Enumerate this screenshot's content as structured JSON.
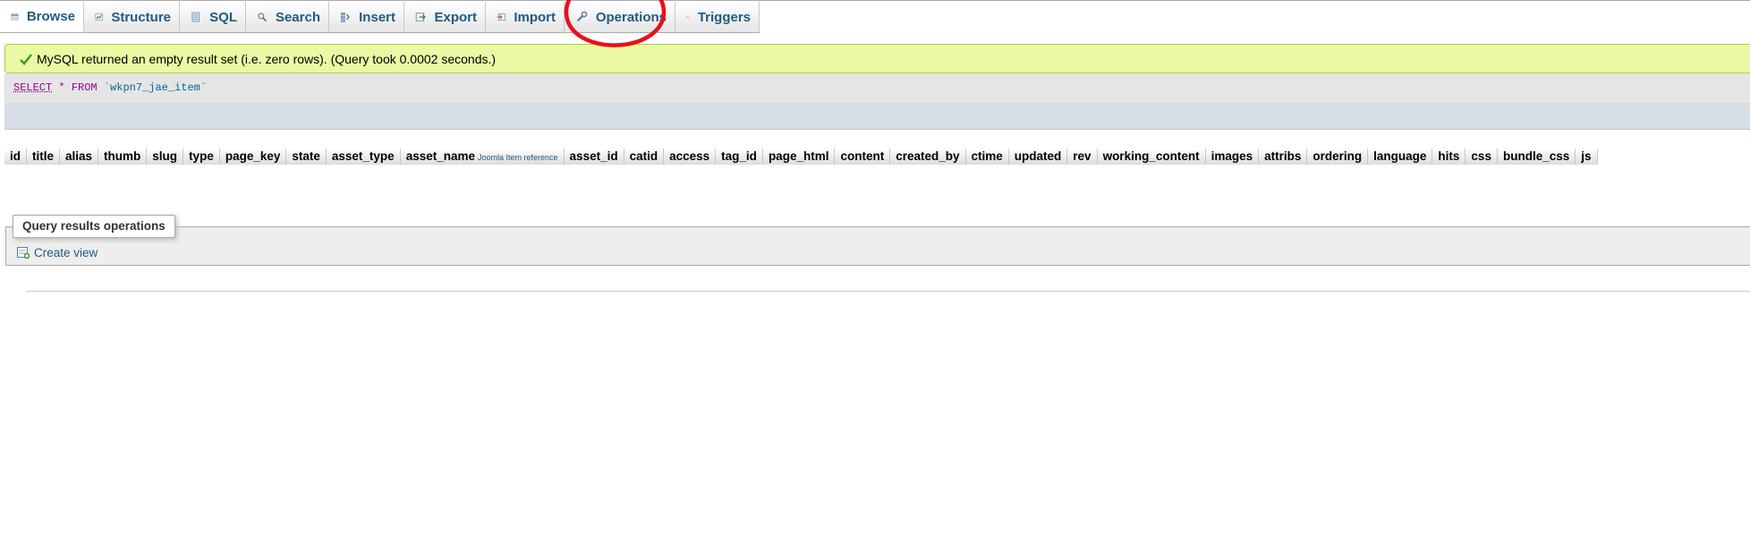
{
  "tabs": [
    {
      "label": "Browse",
      "icon": "browse-icon",
      "active": true
    },
    {
      "label": "Structure",
      "icon": "structure-icon",
      "active": false
    },
    {
      "label": "SQL",
      "icon": "sql-icon",
      "active": false
    },
    {
      "label": "Search",
      "icon": "search-icon",
      "active": false
    },
    {
      "label": "Insert",
      "icon": "insert-icon",
      "active": false
    },
    {
      "label": "Export",
      "icon": "export-icon",
      "active": false
    },
    {
      "label": "Import",
      "icon": "import-icon",
      "active": false
    },
    {
      "label": "Operations",
      "icon": "operations-icon",
      "active": false
    },
    {
      "label": "Triggers",
      "icon": "triggers-icon",
      "active": false
    }
  ],
  "message": {
    "text": "MySQL returned an empty result set (i.e. zero rows). (Query took 0.0002 seconds.)",
    "icon": "check-icon"
  },
  "sql": {
    "select": "SELECT",
    "star": "*",
    "from": "FROM",
    "table": "`wkpn7_jae_item`"
  },
  "columns": [
    "id",
    "title",
    "alias",
    "thumb",
    "slug",
    "type",
    "page_key",
    "state",
    "asset_type",
    "asset_name",
    "asset_id",
    "catid",
    "access",
    "tag_id",
    "page_html",
    "content",
    "created_by",
    "ctime",
    "updated",
    "rev",
    "working_content",
    "images",
    "attribs",
    "ordering",
    "language",
    "hits",
    "css",
    "bundle_css",
    "js"
  ],
  "asset_name_reference": "Joomla Item reference",
  "operations": {
    "legend": "Query results operations",
    "create_view": "Create view"
  },
  "colors": {
    "link": "#235a81",
    "success_bg": "#ebf8a4",
    "success_border": "#a2d246",
    "annotation": "#e8101a"
  }
}
